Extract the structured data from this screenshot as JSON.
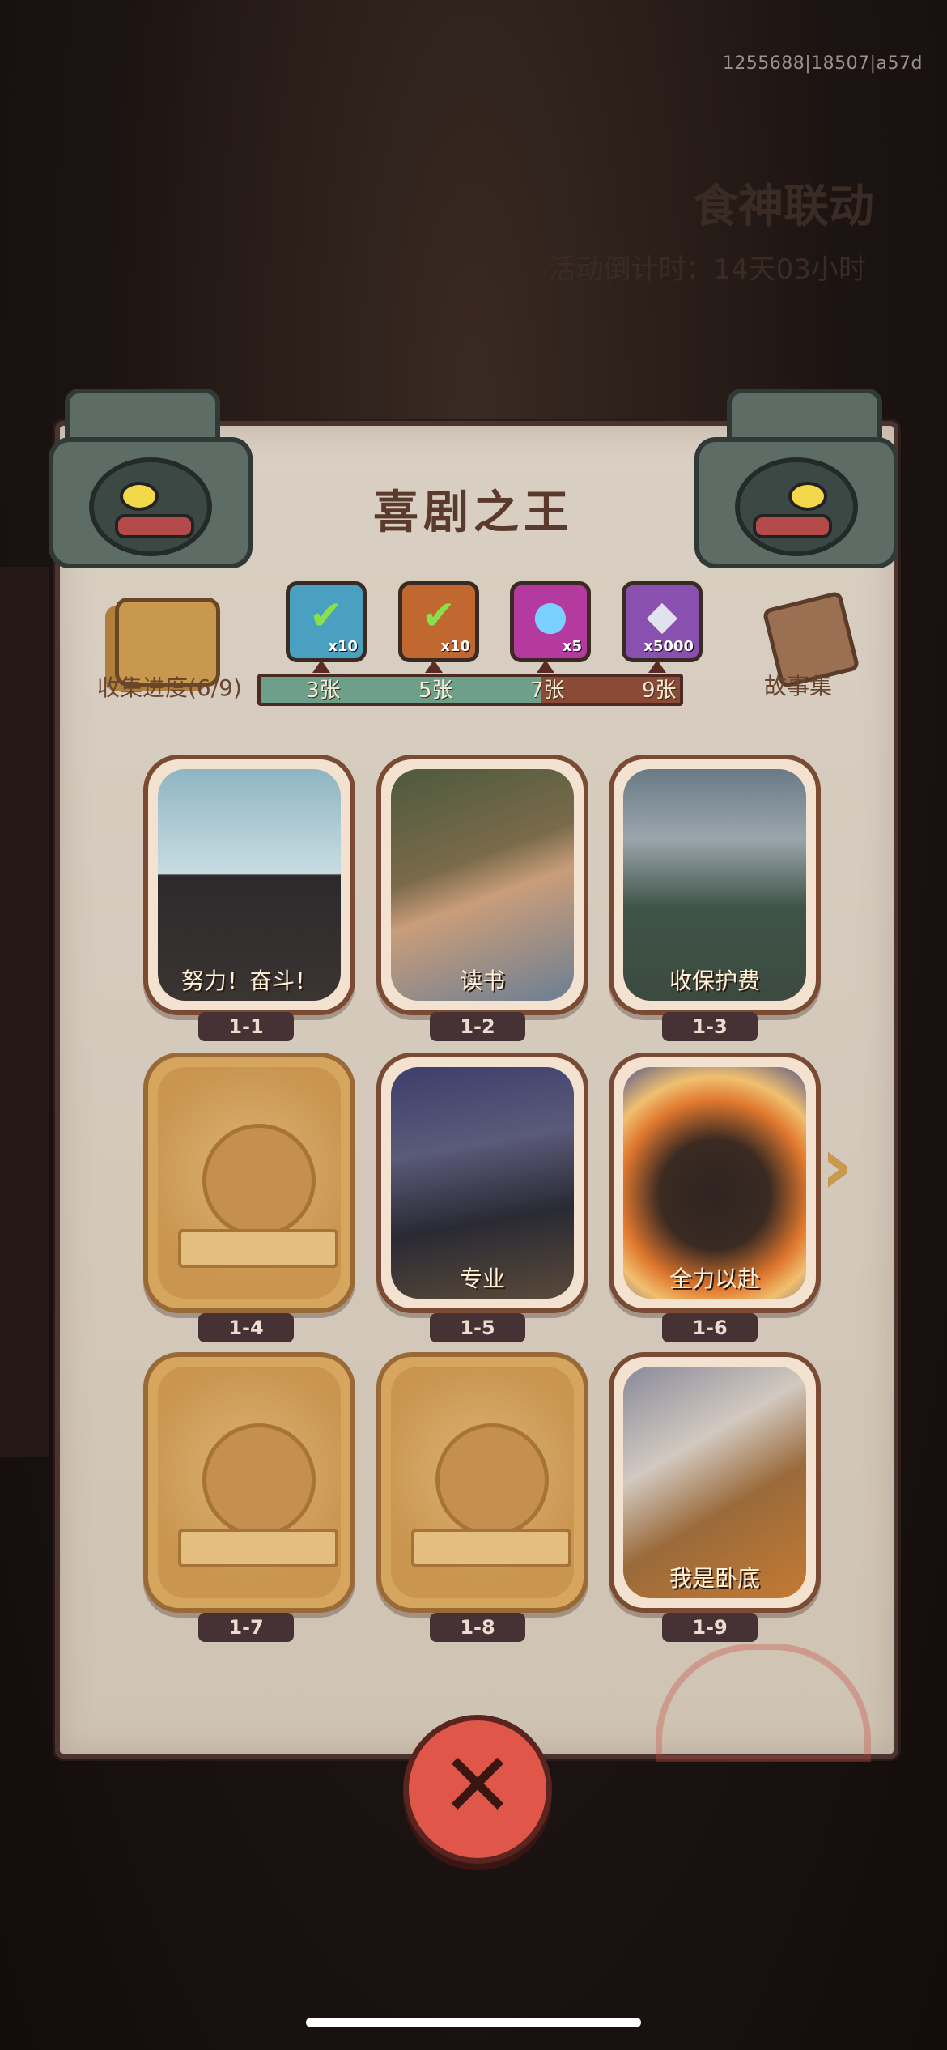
{
  "version_text": "1255688|18507|a57d",
  "background": {
    "event_title": "食神联动",
    "countdown": "活动倒计时：14天03小时"
  },
  "panel": {
    "title": "喜剧之王",
    "collection_label": "收集进度(6/9)",
    "collection_progress": {
      "collected": 6,
      "total": 9
    },
    "story_label": "故事集"
  },
  "rewards": [
    {
      "icon": "chest-check-icon",
      "qty": "x10",
      "threshold_label": "3张"
    },
    {
      "icon": "chest-check-icon",
      "qty": "x10",
      "threshold_label": "5张"
    },
    {
      "icon": "purple-disc-icon",
      "qty": "x5",
      "threshold_label": "7张"
    },
    {
      "icon": "crystal-icon",
      "qty": "x5000",
      "threshold_label": "9张"
    }
  ],
  "progress_bar": {
    "fraction": 0.667,
    "fill_color": "#6e9f8a",
    "empty_color": "#8a4a35"
  },
  "cards": [
    {
      "id": "1-1",
      "caption": "努力！奋斗！",
      "unlocked": true
    },
    {
      "id": "1-2",
      "caption": "读书",
      "unlocked": true
    },
    {
      "id": "1-3",
      "caption": "收保护费",
      "unlocked": true
    },
    {
      "id": "1-4",
      "caption": "",
      "unlocked": false
    },
    {
      "id": "1-5",
      "caption": "专业",
      "unlocked": true
    },
    {
      "id": "1-6",
      "caption": "全力以赴",
      "unlocked": true
    },
    {
      "id": "1-7",
      "caption": "",
      "unlocked": false
    },
    {
      "id": "1-8",
      "caption": "",
      "unlocked": false
    },
    {
      "id": "1-9",
      "caption": "我是卧底",
      "unlocked": true
    }
  ],
  "stamp_text": "喜剧之王",
  "colors": {
    "close_button": "#e0574a",
    "title": "#5a3a2c"
  }
}
